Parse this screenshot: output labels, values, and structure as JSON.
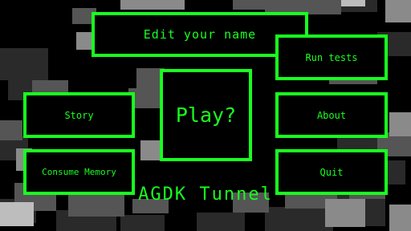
{
  "theme": {
    "accent": "#18ff1f",
    "background": "#000000"
  },
  "menu": {
    "edit_name": "Edit your name",
    "run_tests": "Run tests",
    "story": "Story",
    "play": "Play?",
    "about": "About",
    "consume_memory": "Consume Memory",
    "quit": "Quit"
  },
  "title": "AGDK Tunnel"
}
